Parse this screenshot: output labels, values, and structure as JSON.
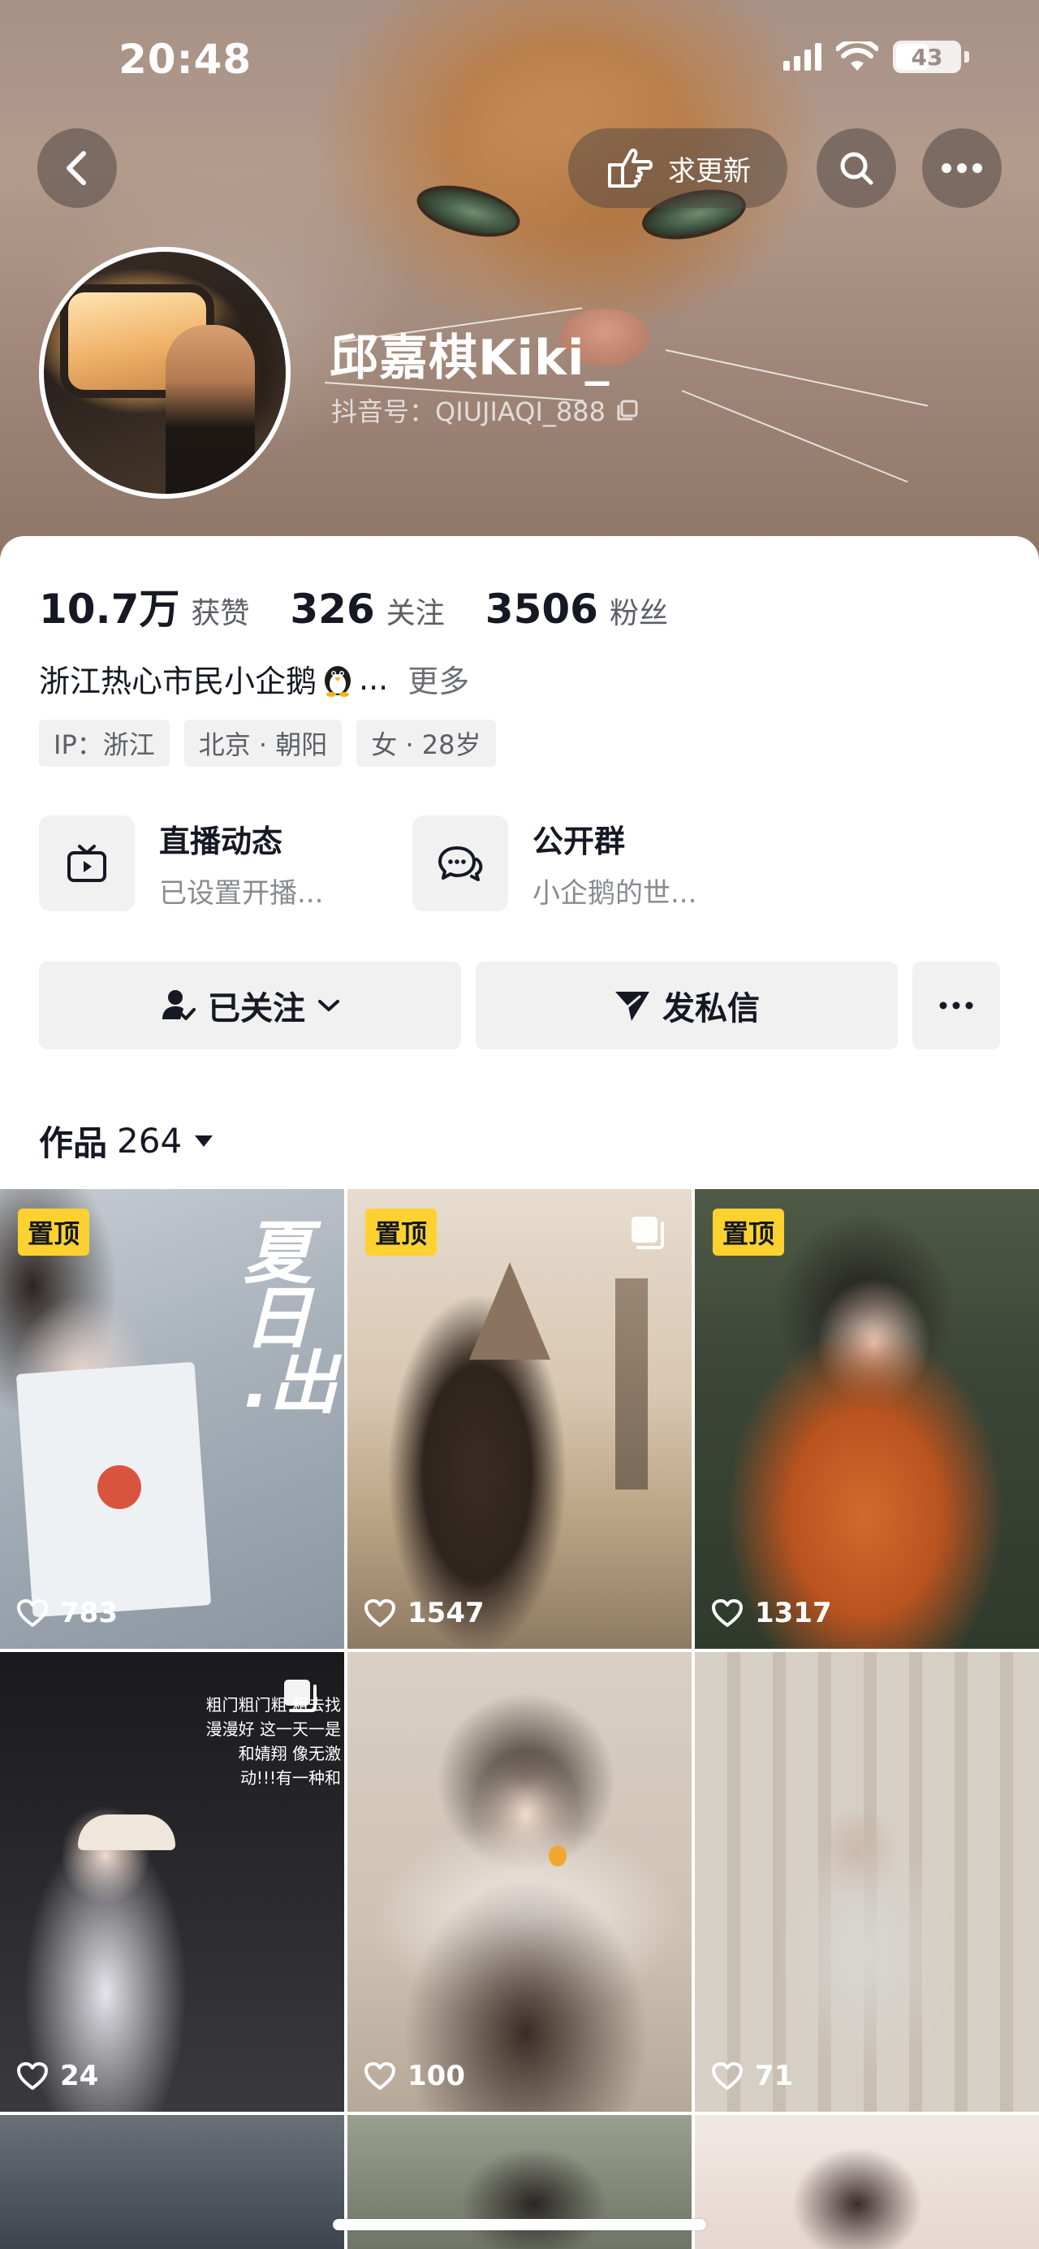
{
  "status_bar": {
    "time": "20:48",
    "battery": "43"
  },
  "header": {
    "request_update_label": "求更新",
    "name": "邱嘉棋Kiki_",
    "douyin_id": "抖音号：QIUJIAQI_888"
  },
  "stats": [
    {
      "value": "10.7万",
      "label": "获赞"
    },
    {
      "value": "326",
      "label": "关注"
    },
    {
      "value": "3506",
      "label": "粉丝"
    }
  ],
  "bio": {
    "text_before": "浙江热心市民小企鹅",
    "ellipsis": "...",
    "more": "更多"
  },
  "tags": [
    "IP：浙江",
    "北京 · 朝阳",
    "女 · 28岁"
  ],
  "features": [
    {
      "title": "直播动态",
      "subtitle": "已设置开播..."
    },
    {
      "title": "公开群",
      "subtitle": "小企鹅的世..."
    }
  ],
  "actions": {
    "following": "已关注",
    "message": "发私信"
  },
  "works": {
    "label": "作品",
    "count": "264"
  },
  "pinned_label": "置顶",
  "tiles": [
    {
      "likes": "783",
      "pinned": true,
      "overlay_text": "夏日 .出"
    },
    {
      "likes": "1547",
      "pinned": true
    },
    {
      "likes": "1317",
      "pinned": true
    },
    {
      "likes": "24",
      "pinned": false,
      "overlay_text": "粗门粗门粗 粗去找漫漫好 这一天一是和婧翔 像无激动!!!有一种和"
    },
    {
      "likes": "100",
      "pinned": false
    },
    {
      "likes": "71",
      "pinned": false
    }
  ]
}
